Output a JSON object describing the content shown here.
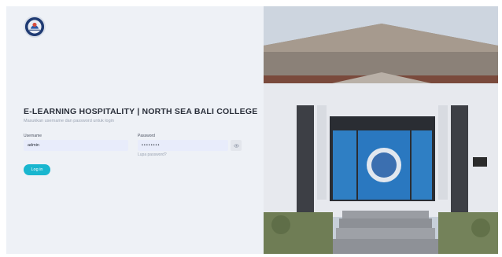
{
  "app": {
    "title": "E-LEARNING HOSPITALITY | NORTH SEA BALI COLLEGE",
    "subtitle": "Masukkan username dan password untuk login"
  },
  "form": {
    "username_label": "Username",
    "username_value": "admin",
    "password_label": "Password",
    "password_value": "••••••••",
    "forgot_label": "Lupa password?",
    "login_label": "Log in",
    "show_password_icon": "eye-icon"
  },
  "branding": {
    "logo_icon": "college-crest-icon",
    "accent_color": "#19b6cf",
    "background_color": "#eef1f6",
    "photo_subject": "campus-building-photo"
  }
}
